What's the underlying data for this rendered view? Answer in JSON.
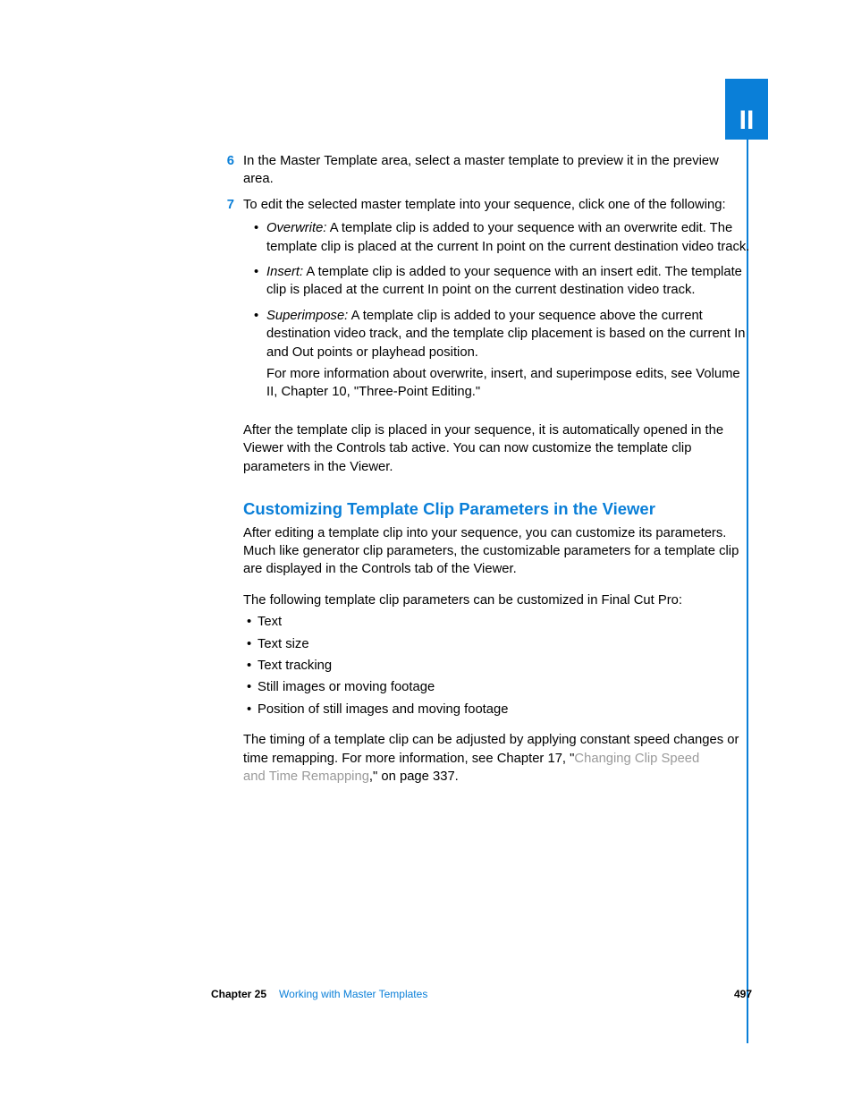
{
  "tab": {
    "label": "II"
  },
  "steps": [
    {
      "num": "6",
      "text": "In the Master Template area, select a master template to preview it in the preview area."
    },
    {
      "num": "7",
      "text": "To edit the selected master template into your sequence, click one of the following:",
      "subitems": [
        {
          "term": "Overwrite:",
          "desc": "  A template clip is added to your sequence with an overwrite edit. The template clip is placed at the current In point on the current destination video track."
        },
        {
          "term": "Insert:",
          "desc": "  A template clip is added to your sequence with an insert edit. The template clip is placed at the current In point on the current destination video track."
        },
        {
          "term": "Superimpose:",
          "desc": "  A template clip is added to your sequence above the current destination video track, and the template clip placement is based on the current In and Out points or playhead position.",
          "followup": "For more information about overwrite, insert, and superimpose edits, see Volume II, Chapter 10, \"Three-Point Editing.\""
        }
      ]
    }
  ],
  "after_para": "After the template clip is placed in your sequence, it is automatically opened in the Viewer with the Controls tab active. You can now customize the template clip parameters in the Viewer.",
  "section": {
    "heading": "Customizing Template Clip Parameters in the Viewer",
    "intro": "After editing a template clip into your sequence, you can customize its parameters. Much like generator clip parameters, the customizable parameters for a template clip are displayed in the Controls tab of the Viewer.",
    "list_intro": "The following template clip parameters can be customized in Final Cut Pro:",
    "items": [
      "Text",
      "Text size",
      "Text tracking",
      "Still images or moving footage",
      "Position of still images and moving footage"
    ],
    "closing_pre": "The timing of a template clip can be adjusted by applying constant speed changes or time remapping. For more information, see Chapter 17, \"",
    "closing_link": "Changing Clip Speed and Time Remapping",
    "closing_post": ",\" on page 337."
  },
  "footer": {
    "chapter_label": "Chapter 25",
    "chapter_title": "Working with Master Templates",
    "page_num": "497"
  }
}
